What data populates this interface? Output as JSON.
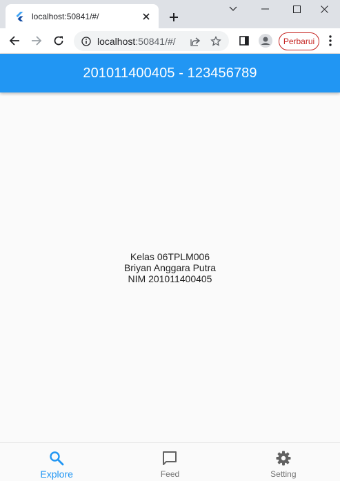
{
  "browser": {
    "tab_title": "localhost:50841/#/",
    "url_host": "localhost",
    "url_rest": ":50841/#/",
    "update_label": "Perbarui"
  },
  "appbar": {
    "title": "201011400405 - 123456789"
  },
  "content": {
    "lines": [
      "Kelas 06TPLM006",
      "Briyan Anggara Putra",
      "NIM 201011400405"
    ]
  },
  "bottom_nav": {
    "items": [
      {
        "label": "Explore",
        "icon": "search-icon",
        "active": true
      },
      {
        "label": "Feed",
        "icon": "chat-bubble-icon",
        "active": false
      },
      {
        "label": "Setting",
        "icon": "gear-icon",
        "active": false
      }
    ]
  },
  "colors": {
    "primary": "#2196f3",
    "update_red": "#c5221f"
  }
}
